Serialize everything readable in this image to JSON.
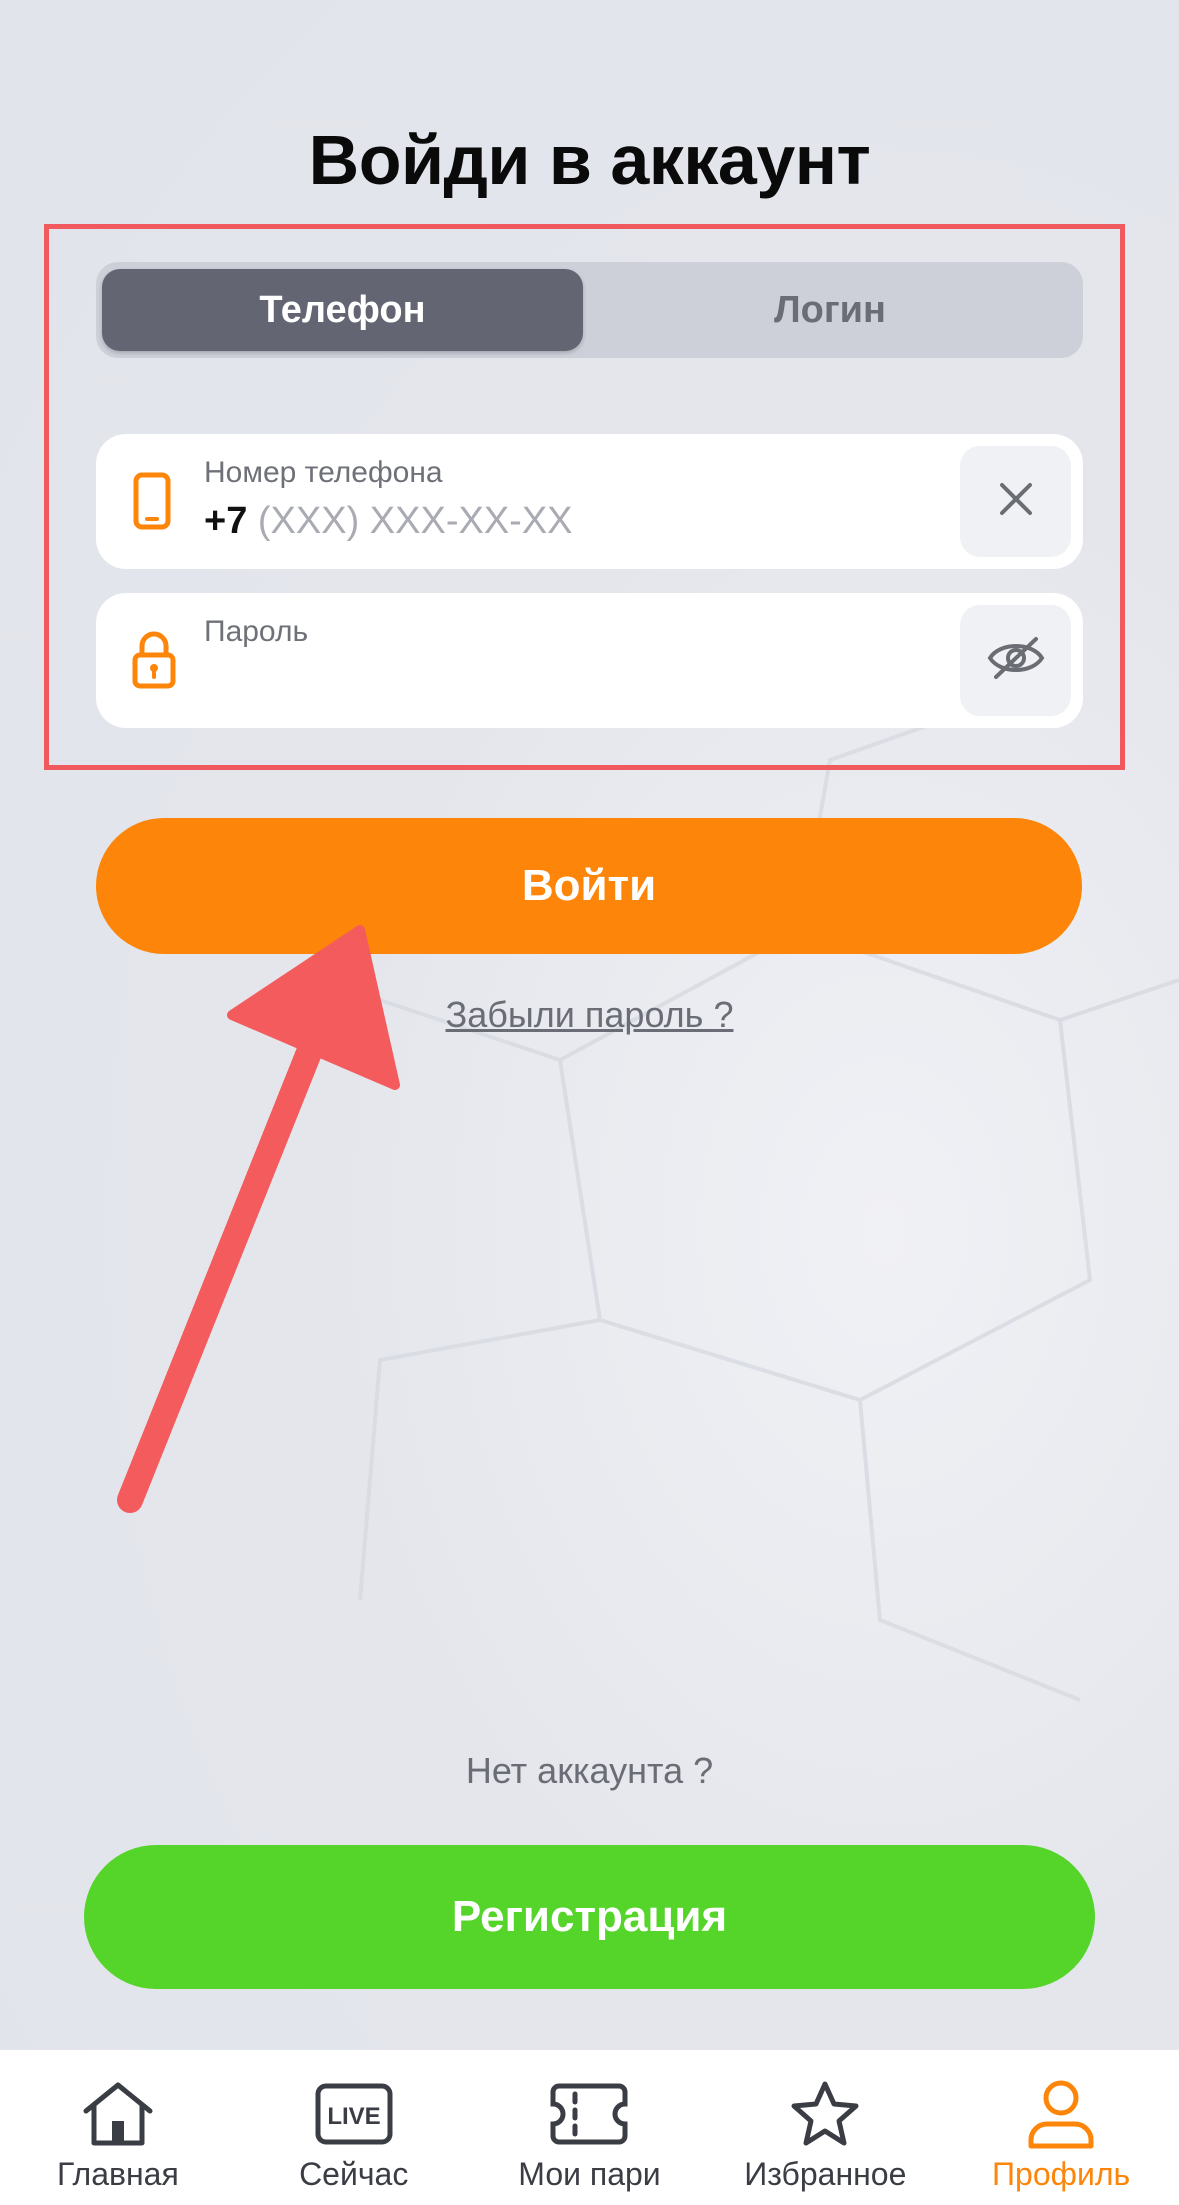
{
  "header": {
    "title": "Войди в аккаунт"
  },
  "segmented": {
    "phone_label": "Телефон",
    "login_label": "Логин",
    "selected": "Телефон"
  },
  "phone_field": {
    "label": "Номер телефона",
    "prefix": "+7",
    "placeholder": "(XXX) XXX-XX-XX"
  },
  "password_field": {
    "label": "Пароль",
    "value": ""
  },
  "actions": {
    "login_label": "Войти",
    "forgot_label": "Забыли пароль ?",
    "no_account_text": "Нет аккаунта ?",
    "register_label": "Регистрация"
  },
  "tabbar": {
    "items": [
      {
        "label": "Главная",
        "icon": "home-icon"
      },
      {
        "label": "Сейчас",
        "icon": "live-icon",
        "badge": "LIVE"
      },
      {
        "label": "Мои пари",
        "icon": "ticket-icon"
      },
      {
        "label": "Избранное",
        "icon": "star-icon"
      },
      {
        "label": "Профиль",
        "icon": "profile-icon"
      }
    ],
    "active": "Профиль"
  },
  "colors": {
    "accent_orange": "#fd8509",
    "register_green": "#55d42a",
    "highlight_red": "#f05a5e",
    "segment_selected": "#636672",
    "background": "#e6e8ef"
  }
}
